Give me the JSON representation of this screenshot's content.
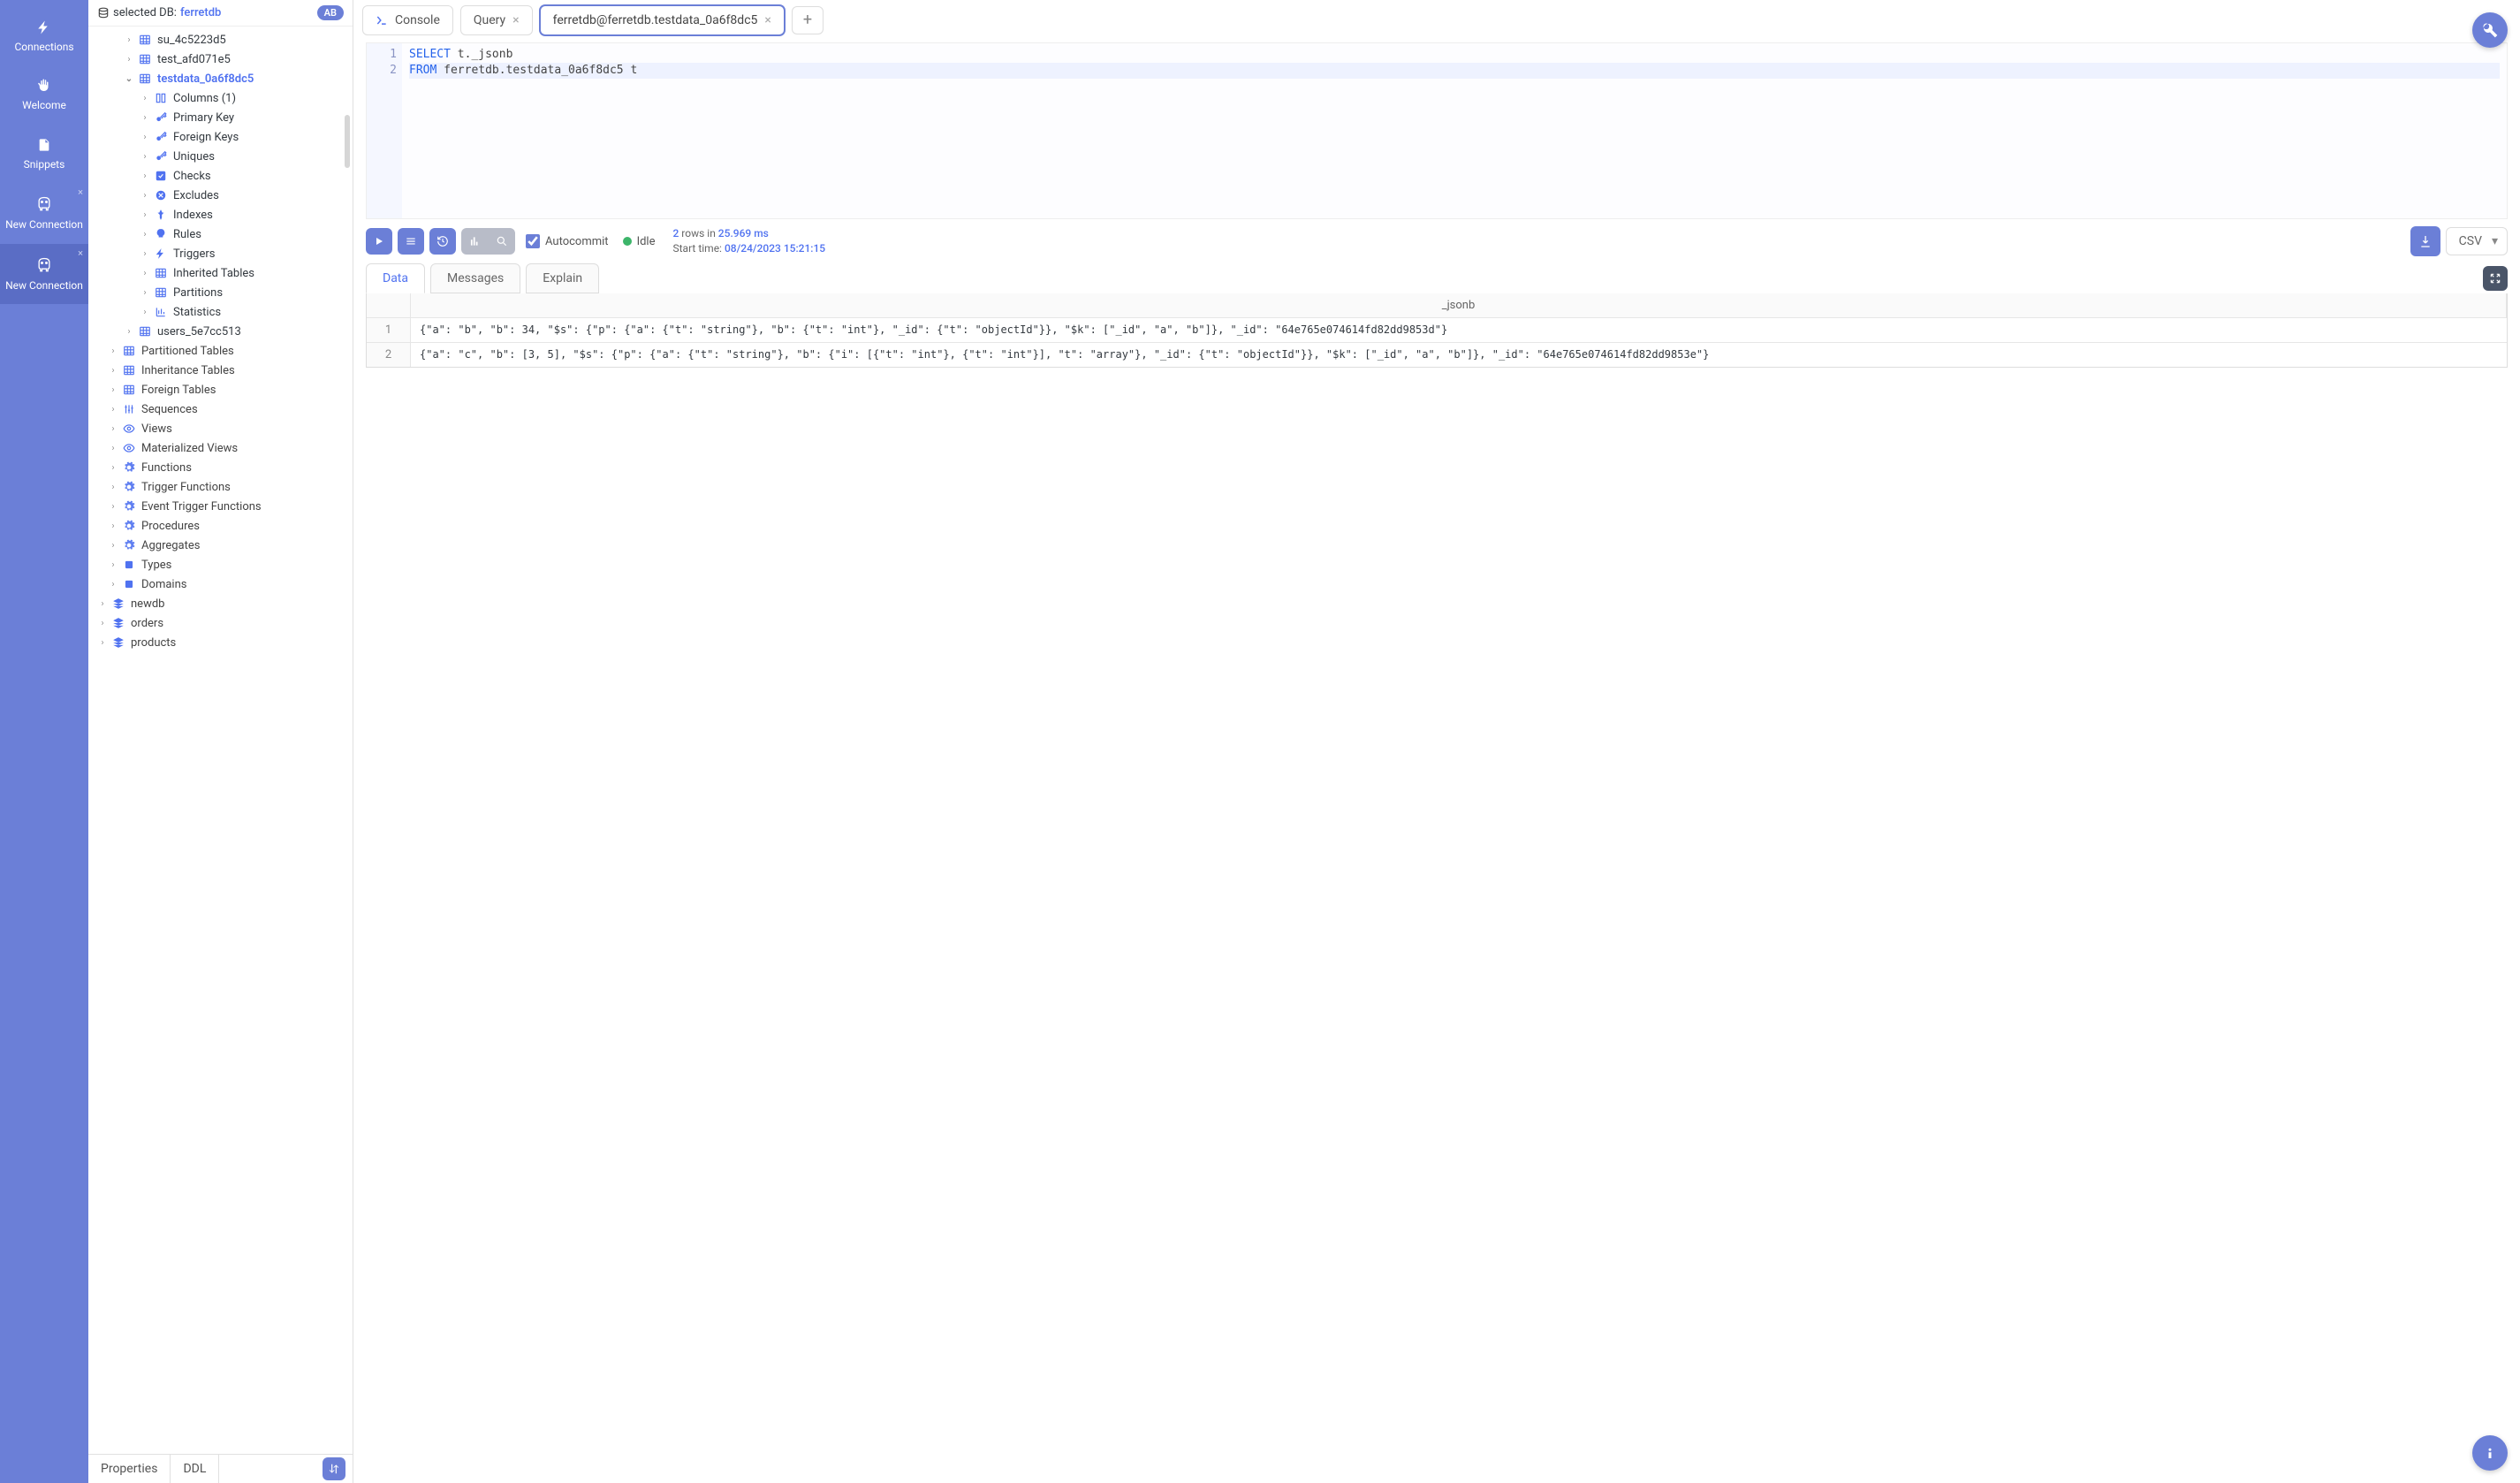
{
  "nav": {
    "connections": "Connections",
    "welcome": "Welcome",
    "snippets": "Snippets",
    "new_connection": "New Connection"
  },
  "sidebar": {
    "selected_label": "selected DB:",
    "selected_db": "ferretdb",
    "badge": "AB",
    "tables": [
      "su_4c5223d5",
      "test_afd071e5",
      "testdata_0a6f8dc5",
      "users_5e7cc513"
    ],
    "table_children": [
      "Columns (1)",
      "Primary Key",
      "Foreign Keys",
      "Uniques",
      "Checks",
      "Excludes",
      "Indexes",
      "Rules",
      "Triggers",
      "Inherited Tables",
      "Partitions",
      "Statistics"
    ],
    "schema_groups": [
      "Partitioned Tables",
      "Inheritance Tables",
      "Foreign Tables",
      "Sequences",
      "Views",
      "Materialized Views",
      "Functions",
      "Trigger Functions",
      "Event Trigger Functions",
      "Procedures",
      "Aggregates",
      "Types",
      "Domains"
    ],
    "other_dbs": [
      "newdb",
      "orders",
      "products"
    ],
    "footer_tabs": {
      "properties": "Properties",
      "ddl": "DDL"
    }
  },
  "tabs": {
    "console": "Console",
    "query": "Query",
    "active": "ferretdb@ferretdb.testdata_0a6f8dc5"
  },
  "editor": {
    "lines": [
      {
        "n": "1",
        "kw": "SELECT",
        "rest": " t._jsonb"
      },
      {
        "n": "2",
        "kw": "FROM",
        "rest": " ferretdb.testdata_0a6f8dc5 t"
      }
    ]
  },
  "toolbar": {
    "autocommit": "Autocommit",
    "idle": "Idle",
    "rows_prefix": "2",
    "rows_mid": " rows in ",
    "rows_time": "25.969 ms",
    "start_label": "Start time: ",
    "start_value": "08/24/2023 15:21:15",
    "csv": "CSV"
  },
  "result_tabs": {
    "data": "Data",
    "messages": "Messages",
    "explain": "Explain"
  },
  "grid": {
    "column": "_jsonb",
    "rows": [
      {
        "n": "1",
        "v": "{\"a\": \"b\", \"b\": 34, \"$s\": {\"p\": {\"a\": {\"t\": \"string\"}, \"b\": {\"t\": \"int\"}, \"_id\": {\"t\": \"objectId\"}}, \"$k\": [\"_id\", \"a\", \"b\"]}, \"_id\": \"64e765e074614fd82dd9853d\"}"
      },
      {
        "n": "2",
        "v": "{\"a\": \"c\", \"b\": [3, 5], \"$s\": {\"p\": {\"a\": {\"t\": \"string\"}, \"b\": {\"i\": [{\"t\": \"int\"}, {\"t\": \"int\"}], \"t\": \"array\"}, \"_id\": {\"t\": \"objectId\"}}, \"$k\": [\"_id\", \"a\", \"b\"]}, \"_id\": \"64e765e074614fd82dd9853e\"}"
      }
    ]
  }
}
